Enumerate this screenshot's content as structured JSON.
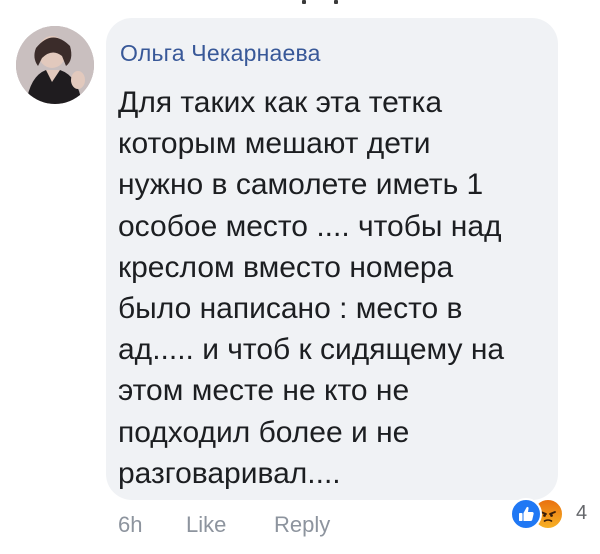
{
  "comment": {
    "author": "Ольга Чекарнаева",
    "text": "Для таких как эта тетка\nкоторым мешают дети\nнужно в самолете иметь 1\nособое место .... чтобы над\nкреслом вместо номера\nбыло написано : место в\nад.....  и чтоб к сидящему на\nэтом месте не кто не\nподходил более и не\nразговаривал....",
    "time": "6h",
    "like_label": "Like",
    "reply_label": "Reply",
    "reaction_count": "4",
    "reactions": [
      "like-icon",
      "angry-icon"
    ]
  },
  "colors": {
    "bubble": "#f0f2f5",
    "author": "#385898",
    "text": "#1c1e21",
    "meta": "#8d949e",
    "like_blue": "#2078f4",
    "angry_orange": "#e9710f"
  }
}
